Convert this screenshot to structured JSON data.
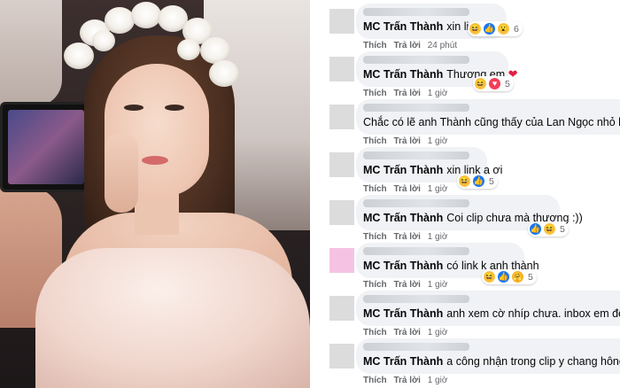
{
  "photo": {
    "alt": "Ảnh Lan Ngọc đội vòng hoa trắng"
  },
  "comments": [
    {
      "mention": "MC Trấn Thành",
      "text": "xin link",
      "like_label": "Thích",
      "reply_label": "Trả lời",
      "time": "24 phút",
      "reactions": [
        "haha",
        "like",
        "wow"
      ],
      "reaction_count": "6",
      "avatar": "gray"
    },
    {
      "mention": "MC Trấn Thành",
      "text": "Thương em",
      "heart": "❤",
      "like_label": "Thích",
      "reply_label": "Trả lời",
      "time": "1 giờ",
      "reactions": [
        "haha",
        "love"
      ],
      "reaction_count": "5",
      "avatar": "gray"
    },
    {
      "mention": "",
      "text": "Chắc có lẽ anh Thành cũng thấy của Lan Ngọc nhỏ hơn của",
      "like_label": "Thích",
      "reply_label": "Trả lời",
      "time": "1 giờ",
      "reactions": [],
      "reaction_count": "",
      "avatar": "gray"
    },
    {
      "mention": "MC Trấn Thành",
      "text": "xin link a ơi",
      "like_label": "Thích",
      "reply_label": "Trả lời",
      "time": "1 giờ",
      "reactions": [
        "haha",
        "like"
      ],
      "reaction_count": "5",
      "avatar": "gray"
    },
    {
      "mention": "MC Trấn Thành",
      "text": "Coi clip chưa mà thương :))",
      "like_label": "Thích",
      "reply_label": "Trả lời",
      "time": "1 giờ",
      "reactions": [
        "like",
        "haha"
      ],
      "reaction_count": "5",
      "avatar": "gray"
    },
    {
      "mention": "MC Trấn Thành",
      "text": "có link k anh thành",
      "like_label": "Thích",
      "reply_label": "Trả lời",
      "time": "1 giờ",
      "reactions": [
        "haha",
        "like",
        "care"
      ],
      "reaction_count": "5",
      "avatar": "pink"
    },
    {
      "mention": "MC Trấn Thành",
      "text": "anh xem cờ nhíp chưa. inbox em để lấy link",
      "like_label": "Thích",
      "reply_label": "Trả lời",
      "time": "1 giờ",
      "reactions": [],
      "reaction_count": "",
      "avatar": "gray"
    },
    {
      "mention": "MC Trấn Thành",
      "text": "a công nhận trong clip y chang hông , a nh",
      "like_label": "Thích",
      "reply_label": "Trả lời",
      "time": "1 giờ",
      "reactions": [],
      "reaction_count": "",
      "avatar": "gray"
    }
  ],
  "colors": {
    "bubble": "#f0f2f5",
    "text": "#050505",
    "meta": "#65676b",
    "like_blue": "#1877f2",
    "love_red": "#f33e58",
    "haha_yellow": "#f7c646"
  },
  "icons": {
    "haha": "haha-reaction-icon",
    "like": "like-reaction-icon",
    "love": "love-reaction-icon",
    "wow": "wow-reaction-icon",
    "care": "care-reaction-icon",
    "heart": "heart-icon"
  }
}
